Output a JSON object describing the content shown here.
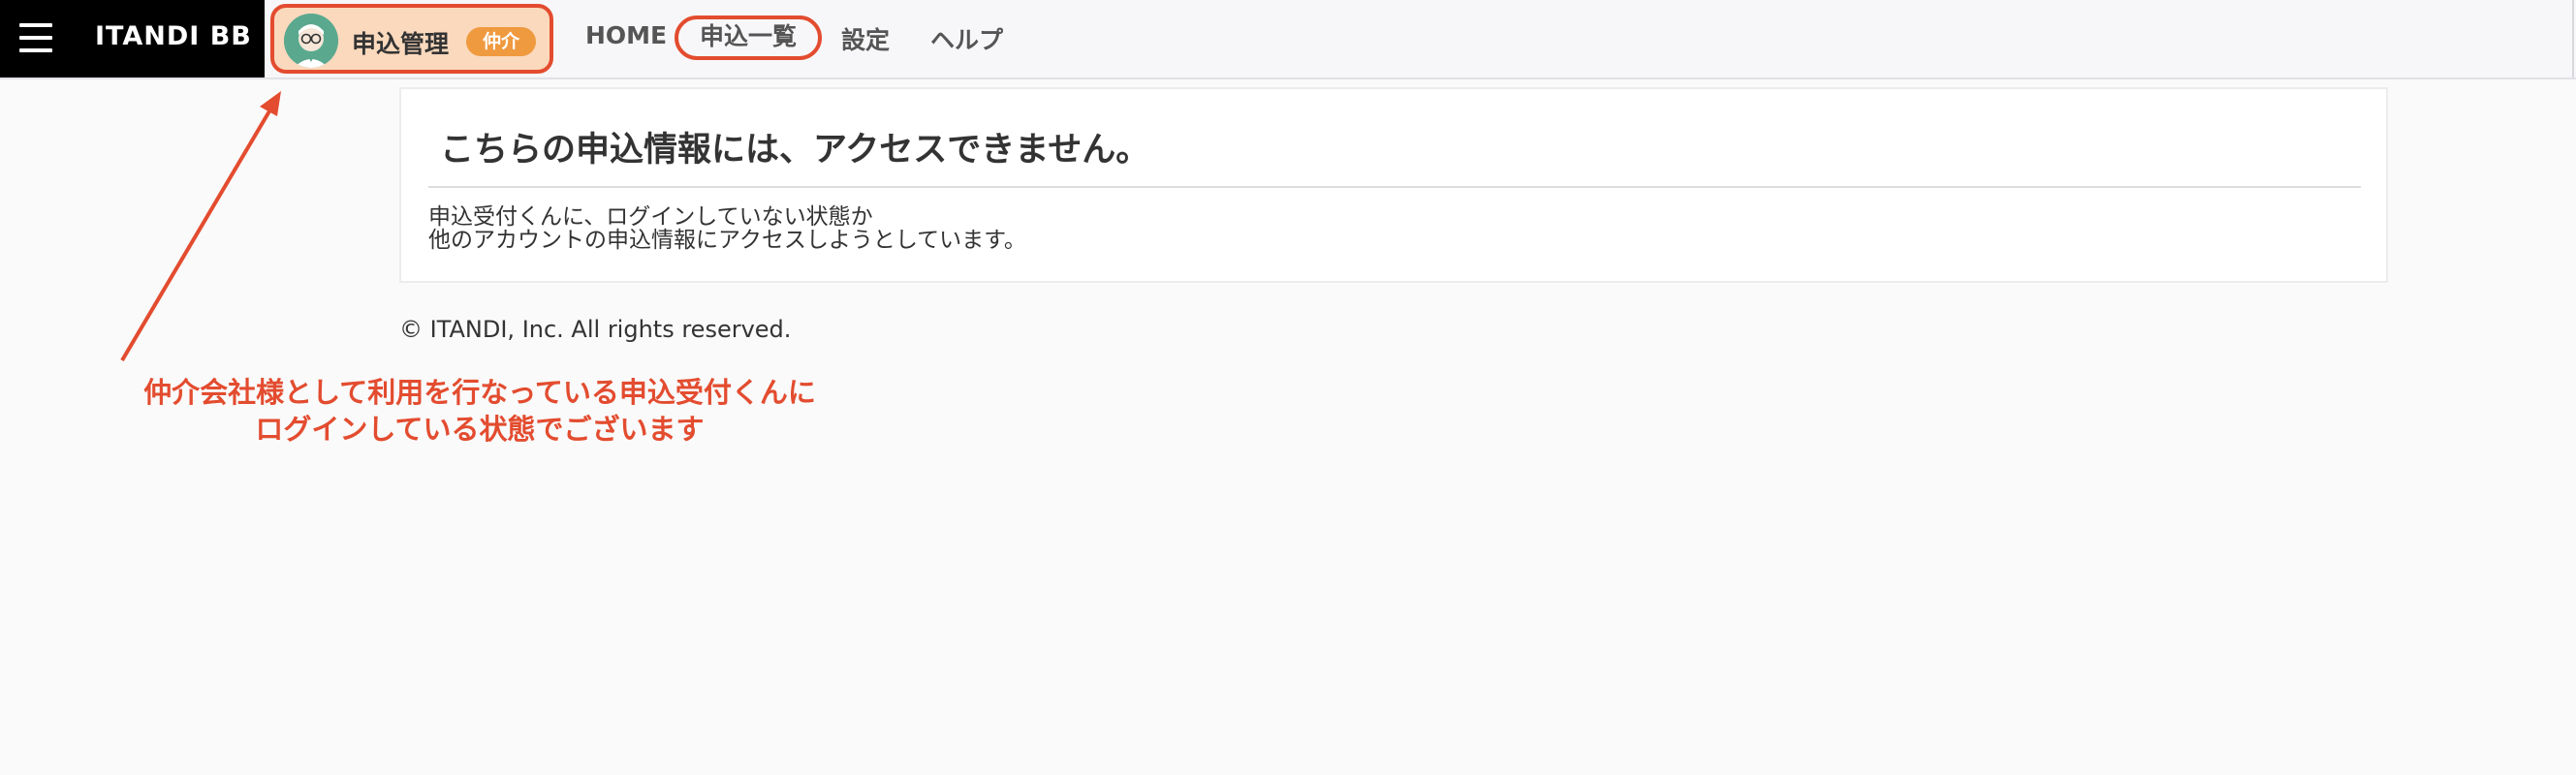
{
  "header": {
    "brand": "ITANDI BB",
    "menu_icon": "hamburger-menu-icon",
    "app_switcher": {
      "label": "申込管理",
      "badge": "仲介",
      "avatar_icon": "user-avatar-icon"
    },
    "nav": [
      {
        "label": "HOME"
      },
      {
        "label": "申込一覧"
      },
      {
        "label": "設定"
      },
      {
        "label": "ヘルプ"
      }
    ]
  },
  "main": {
    "title": "こちらの申込情報には、アクセスできません。",
    "lines": [
      "申込受付くんに、ログインしていない状態か",
      "他のアカウントの申込情報にアクセスしようとしています。"
    ]
  },
  "footer": {
    "copyright": "© ITANDI, Inc. All rights reserved."
  },
  "annotation": {
    "line1": "仲介会社様として利用を行なっている申込受付くんに",
    "line2": "ログインしている状態でございます",
    "arrow_icon": "arrow-icon"
  },
  "colors": {
    "annotation": "#e34c2f",
    "brand_bg": "#000000",
    "app_switch_bg": "#fbd9bd",
    "badge_bg": "#ef9a3f"
  }
}
